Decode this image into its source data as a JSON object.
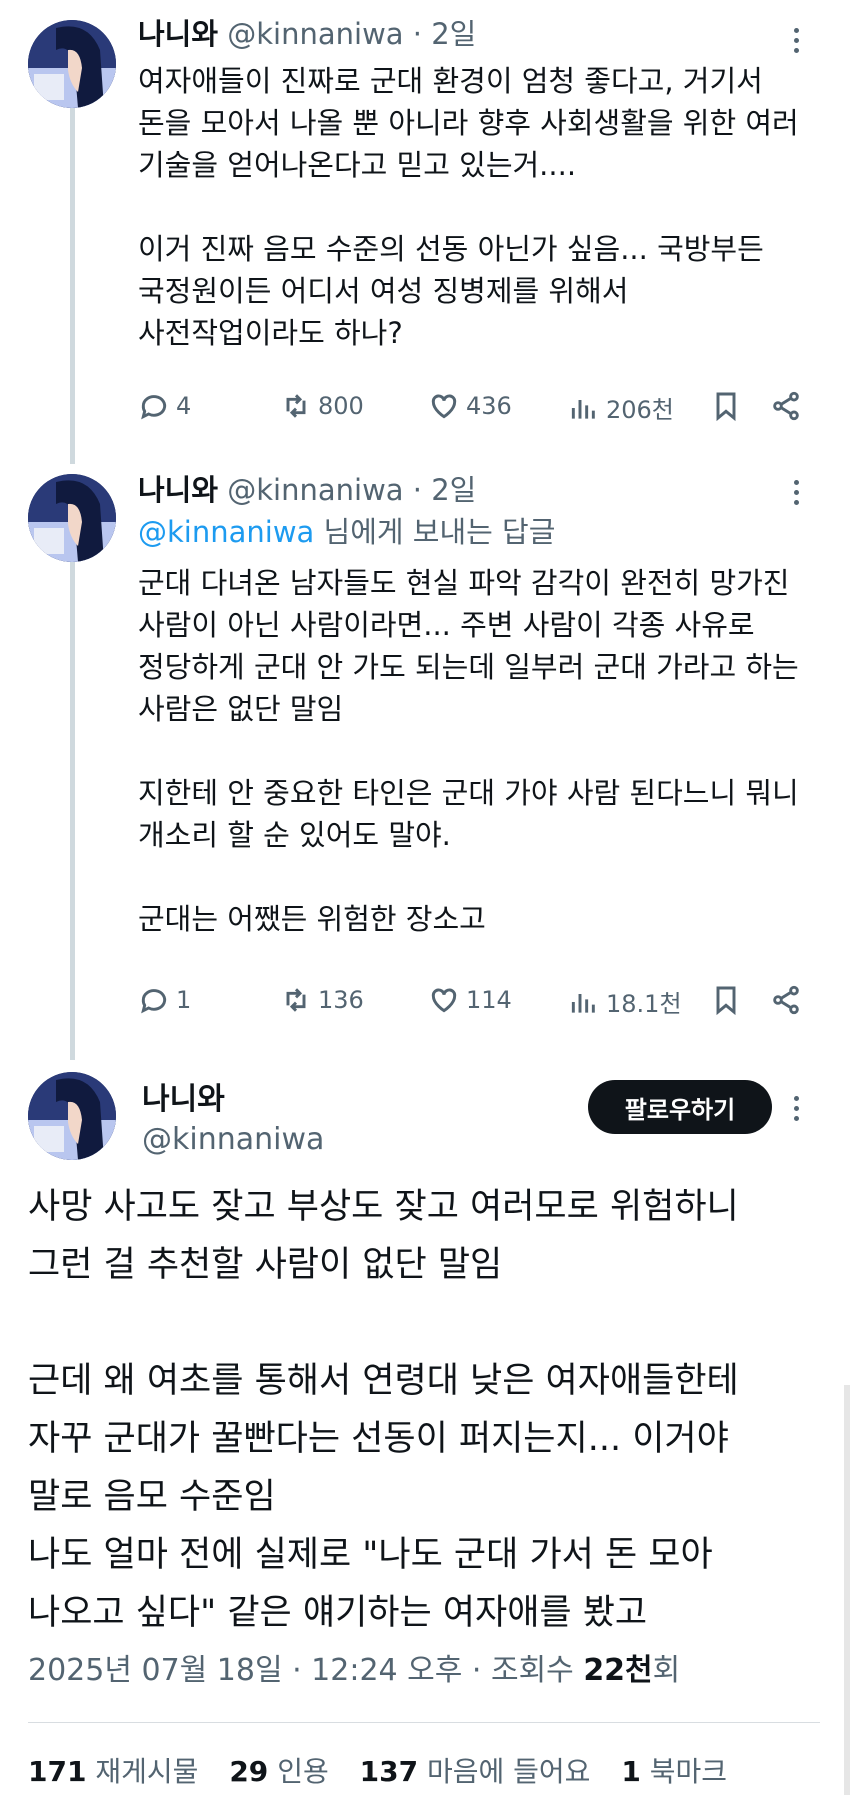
{
  "author": {
    "name": "나니와",
    "handle": "@kinnaniwa"
  },
  "tweets": [
    {
      "time": "2일",
      "body": "여자애들이 진짜로 군대 환경이 엄청 좋다고, 거기서\n돈을 모아서 나올 뿐 아니라 향후 사회생활을 위한 여러\n기술을 얻어나온다고 믿고 있는거....\n\n이거 진짜 음모 수준의 선동 아닌가 싶음... 국방부든\n국정원이든 어디서 여성 징병제를 위해서\n사전작업이라도 하나?",
      "replies": "4",
      "retweets": "800",
      "likes": "436",
      "views": "206천"
    },
    {
      "time": "2일",
      "reply_mention": "@kinnaniwa",
      "reply_suffix": " 님에게 보내는 답글",
      "body": "군대 다녀온 남자들도 현실 파악 감각이 완전히 망가진\n사람이 아닌 사람이라면... 주변 사람이 각종 사유로\n정당하게 군대 안 가도 되는데 일부러 군대 가라고 하는\n사람은 없단 말임\n\n지한테 안 중요한 타인은 군대 가야 사람 된다느니 뭐니\n개소리 할 순 있어도 말야.\n\n군대는 어쨌든 위험한 장소고",
      "replies": "1",
      "retweets": "136",
      "likes": "114",
      "views": "18.1천"
    }
  ],
  "main_tweet": {
    "follow_label": "팔로우하기",
    "body": "사망 사고도 잦고 부상도 잦고 여러모로 위험하니\n그런 걸 추천할 사람이 없단 말임\n\n근데 왜 여초를 통해서 연령대 낮은 여자애들한테\n자꾸 군대가 꿀빤다는 선동이 퍼지는지... 이거야\n말로 음모 수준임\n나도 얼마 전에 실제로 \"나도 군대 가서 돈 모아\n나오고 싶다\" 같은 얘기하는 여자애를 봤고",
    "date": "2025년 07월 18일 · 12:24 오후 · 조회수 ",
    "views": "22천",
    "views_suffix": "회",
    "stats": {
      "retweets_count": "171",
      "retweets_label": "재게시물",
      "quotes_count": "29",
      "quotes_label": "인용",
      "likes_count": "137",
      "likes_label": "마음에 들어요",
      "bookmarks_count": "1",
      "bookmarks_label": "북마크"
    }
  },
  "colors": {
    "text": "#0f1419",
    "secondary": "#536471",
    "link": "#1d9bf0",
    "thread_line": "#cfd9de",
    "button_bg": "#0f1419"
  },
  "icons": [
    "reply-icon",
    "retweet-icon",
    "like-icon",
    "views-icon",
    "bookmark-icon",
    "share-icon",
    "more-icon"
  ]
}
